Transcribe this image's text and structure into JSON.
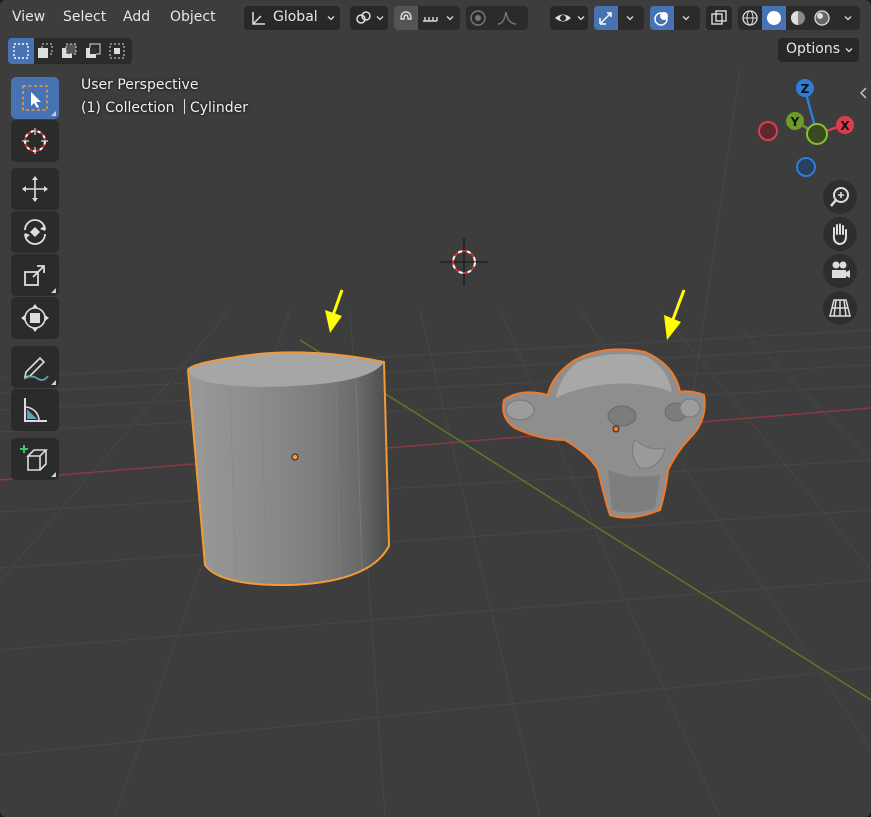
{
  "menu": {
    "view": "View",
    "select": "Select",
    "add": "Add",
    "object": "Object"
  },
  "header": {
    "transform_orientation": "Global",
    "options_label": "Options"
  },
  "overlay": {
    "view_name": "User Perspective",
    "collection": "(1) Collection",
    "active_object": "Cylinder"
  },
  "gizmo": {
    "z": "Z",
    "y": "Y",
    "x": "X"
  },
  "colors": {
    "active_blue": "#4772b3",
    "selection_outline": "#f09a3a",
    "annotation_arrow": "#ffff00",
    "axis_x": "#dc3c52",
    "axis_y": "#6e9a28",
    "axis_z": "#2e7dd6"
  },
  "tools": [
    "select-box",
    "cursor",
    "move",
    "rotate",
    "scale",
    "transform",
    "annotate",
    "measure",
    "add-cube"
  ]
}
